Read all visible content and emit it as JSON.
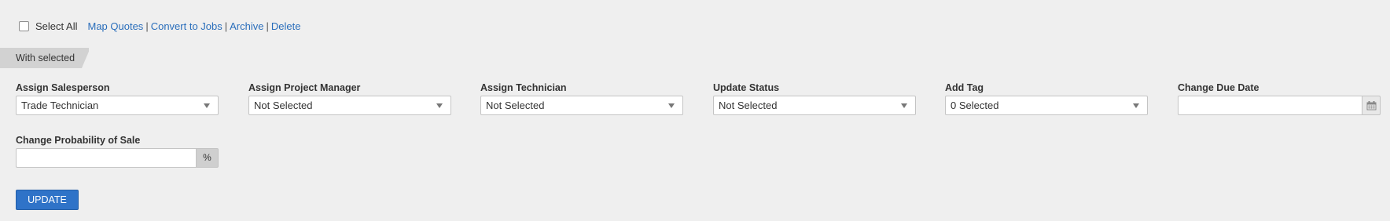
{
  "top_bar": {
    "select_all_label": "Select All",
    "select_all_checked": false,
    "actions": [
      "Map Quotes",
      "Convert to Jobs",
      "Archive",
      "Delete"
    ],
    "separator": "|"
  },
  "with_selected_label": "With selected",
  "fields": {
    "assign_salesperson": {
      "label": "Assign Salesperson",
      "value": "Trade Technician"
    },
    "assign_project_manager": {
      "label": "Assign Project Manager",
      "value": "Not Selected"
    },
    "assign_technician": {
      "label": "Assign Technician",
      "value": "Not Selected"
    },
    "update_status": {
      "label": "Update Status",
      "value": "Not Selected"
    },
    "add_tag": {
      "label": "Add Tag",
      "value": "0 Selected"
    },
    "change_due_date": {
      "label": "Change Due Date",
      "value": ""
    },
    "change_probability": {
      "label": "Change Probability of Sale",
      "value": "",
      "unit": "%"
    }
  },
  "update_button_label": "UPDATE",
  "colors": {
    "accent": "#2f73c8",
    "link": "#2a6ebb",
    "background": "#efefef"
  }
}
